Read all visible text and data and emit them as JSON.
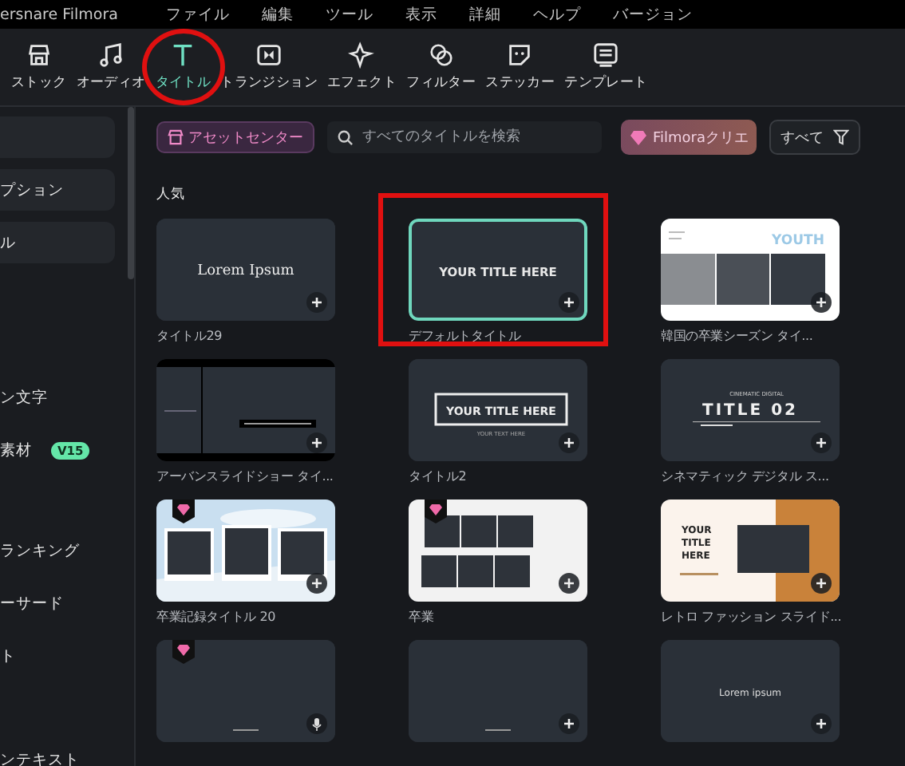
{
  "menu_bar": {
    "app_title": "ersnare Filmora",
    "items": [
      "ファイル",
      "編集",
      "ツール",
      "表示",
      "詳細",
      "ヘルプ",
      "バージョン"
    ]
  },
  "toolbar": {
    "tabs": [
      {
        "label": "ストック",
        "selected": false,
        "annotated": false
      },
      {
        "label": "オーディオ",
        "selected": false,
        "annotated": false
      },
      {
        "label": "タイトル",
        "selected": true,
        "annotated": true
      },
      {
        "label": "トランジション",
        "selected": false,
        "annotated": false
      },
      {
        "label": "エフェクト",
        "selected": false,
        "annotated": false
      },
      {
        "label": "フィルター",
        "selected": false,
        "annotated": false
      },
      {
        "label": "ステッカー",
        "selected": false,
        "annotated": false
      },
      {
        "label": "テンプレート",
        "selected": false,
        "annotated": false
      }
    ]
  },
  "sidebar": {
    "sections": [
      [
        {
          "kind": "card"
        },
        {
          "kind": "card",
          "label": "プション"
        },
        {
          "kind": "card",
          "label": "ル"
        }
      ],
      [
        {
          "kind": "link",
          "label": "ン文字"
        },
        {
          "kind": "link",
          "label": "素材",
          "badge": "V15"
        }
      ],
      [
        {
          "kind": "link",
          "label": "ランキング"
        },
        {
          "kind": "link",
          "label": "ーサード"
        },
        {
          "kind": "link",
          "label": "ト"
        }
      ],
      [
        {
          "kind": "link",
          "label": "ンテキスト"
        }
      ]
    ]
  },
  "filter_bar": {
    "asset_center": "アセットセンター",
    "search": {
      "placeholder": "すべてのタイトルを検索"
    },
    "creator_button": "Filmoraクリエ",
    "all_button": "すべて"
  },
  "section_title": "人気",
  "cards": [
    {
      "preview_text": [
        "Lorem Ipsum"
      ],
      "label": "タイトル29",
      "premium": false,
      "selected": false,
      "annotated": false
    },
    {
      "preview_text": [
        "YOUR TITLE HERE"
      ],
      "label": "デフォルトタイトル",
      "premium": false,
      "selected": true,
      "annotated": true
    },
    {
      "preview_text": [
        "YOUTH"
      ],
      "label": "韓国の卒業シーズン タイ...",
      "premium": false,
      "selected": false,
      "annotated": false
    },
    {
      "label": "アーバンスライドショー タイ...",
      "premium": false,
      "selected": false,
      "annotated": false
    },
    {
      "preview_text": [
        "YOUR TITLE HERE",
        "YOUR TEXT HERE"
      ],
      "label": "タイトル2",
      "premium": false,
      "selected": false,
      "annotated": false
    },
    {
      "preview_text": [
        "CINEMATIC DIGITAL",
        "TITLE 02"
      ],
      "label": "シネマティック デジタル ス...",
      "premium": false,
      "selected": false,
      "annotated": false
    },
    {
      "label": "卒業記録タイトル 20",
      "premium": true,
      "selected": false,
      "annotated": false
    },
    {
      "label": "卒業",
      "premium": true,
      "selected": false,
      "annotated": false
    },
    {
      "preview_text": [
        "YOUR",
        "TITLE",
        "HERE"
      ],
      "label": "レトロ ファッション スライド...",
      "premium": false,
      "selected": false,
      "annotated": false
    },
    {
      "premium": true,
      "selected": false,
      "annotated": false
    },
    {
      "premium": false,
      "selected": false,
      "annotated": false
    },
    {
      "preview_text": [
        "Lorem ipsum"
      ],
      "premium": false,
      "selected": false,
      "annotated": false
    }
  ]
}
